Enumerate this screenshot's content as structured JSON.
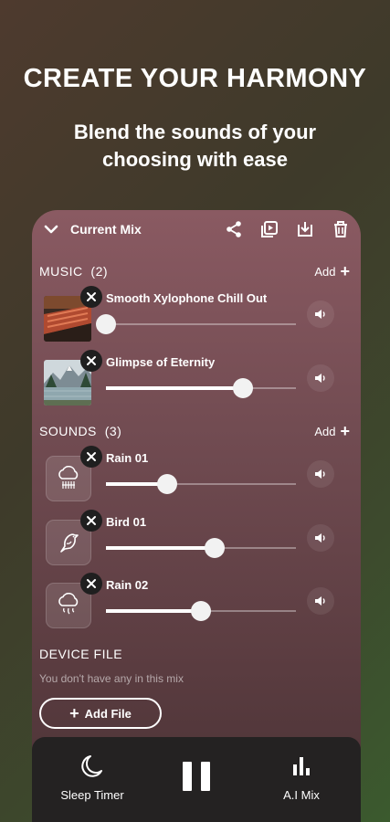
{
  "header": {
    "headline": "CREATE YOUR HARMONY",
    "subline": "Blend the sounds of your choosing with ease"
  },
  "topbar": {
    "title": "Current Mix",
    "icons": [
      "chevron-down-icon",
      "share-icon",
      "playlist-play-icon",
      "download-icon",
      "trash-icon"
    ]
  },
  "music": {
    "title": "MUSIC",
    "count": "(2)",
    "add_label": "Add",
    "tracks": [
      {
        "name": "Smooth Xylophone Chill Out",
        "volume": 0.0
      },
      {
        "name": "Glimpse of Eternity",
        "volume": 0.72
      }
    ]
  },
  "sounds": {
    "title": "SOUNDS",
    "count": "(3)",
    "add_label": "Add",
    "tracks": [
      {
        "name": "Rain 01",
        "icon": "cloud-rain-icon",
        "volume": 0.32
      },
      {
        "name": "Bird 01",
        "icon": "bird-icon",
        "volume": 0.57
      },
      {
        "name": "Rain 02",
        "icon": "cloud-drizzle-icon",
        "volume": 0.5
      }
    ]
  },
  "device": {
    "title": "DEVICE FILE",
    "empty_text": "You don't have any in this mix",
    "add_label": "Add File"
  },
  "bottom": {
    "sleep_label": "Sleep Timer",
    "ai_label": "A.I Mix",
    "play_state": "pause-icon"
  },
  "colors": {
    "panel_top": "#8a5a62",
    "panel_bottom": "#4a3235",
    "bottom_bar": "#242222"
  }
}
